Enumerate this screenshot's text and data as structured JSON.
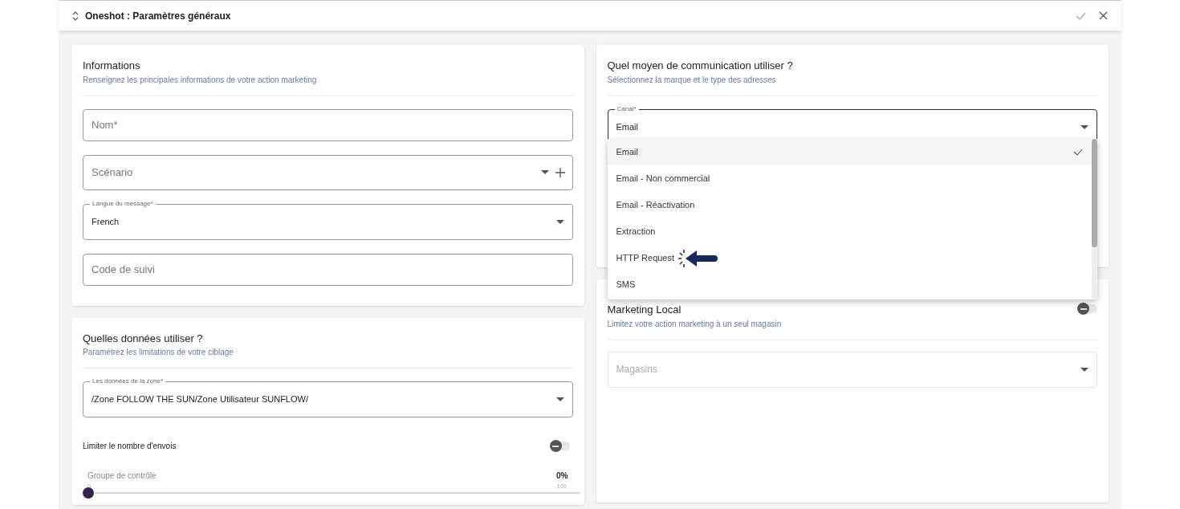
{
  "window": {
    "title": "Oneshot : Paramètres généraux"
  },
  "informations": {
    "title": "Informations",
    "subtitle": "Renseignez les principales informations de votre action marketing",
    "fields": [
      {
        "kind": "text",
        "placeholder": "Nom*"
      },
      {
        "kind": "combo",
        "placeholder": "Scénario"
      },
      {
        "kind": "select",
        "label": "Langue du message*",
        "value": "French"
      },
      {
        "kind": "text",
        "placeholder": "Code de suivi"
      }
    ]
  },
  "donnees": {
    "title": "Quelles données utiliser ?",
    "subtitle": "Paramétrez les limitations de votre ciblage",
    "zone": {
      "label": "Les données de la zone*",
      "value": "/Zone FOLLOW THE SUN/Zone Utilisateur SUNFLOW/"
    },
    "limit": {
      "label": "Limiter le nombre d'envois",
      "on": false
    },
    "slider": {
      "label": "Groupe de contrôle",
      "reading": "0%",
      "min": "0",
      "max": "100",
      "level": 0
    }
  },
  "communication": {
    "title": "Quel moyen de communication utiliser ?",
    "subtitle": "Sélectionnez la marque et le type des adresses",
    "canal": {
      "label": "Canal*",
      "value": "Email"
    },
    "options": [
      {
        "label": "Email",
        "selected": true
      },
      {
        "label": "Email - Non commercial",
        "selected": false
      },
      {
        "label": "Email - Réactivation",
        "selected": false
      },
      {
        "label": "Extraction",
        "selected": false
      },
      {
        "label": "HTTP Request",
        "selected": false
      },
      {
        "label": "SMS",
        "selected": false
      }
    ]
  },
  "local": {
    "title": "Marketing Local",
    "subtitle": "Limitez votre action marketing à un seul magasin",
    "on": false,
    "stores": {
      "placeholder": "Magasins"
    }
  }
}
